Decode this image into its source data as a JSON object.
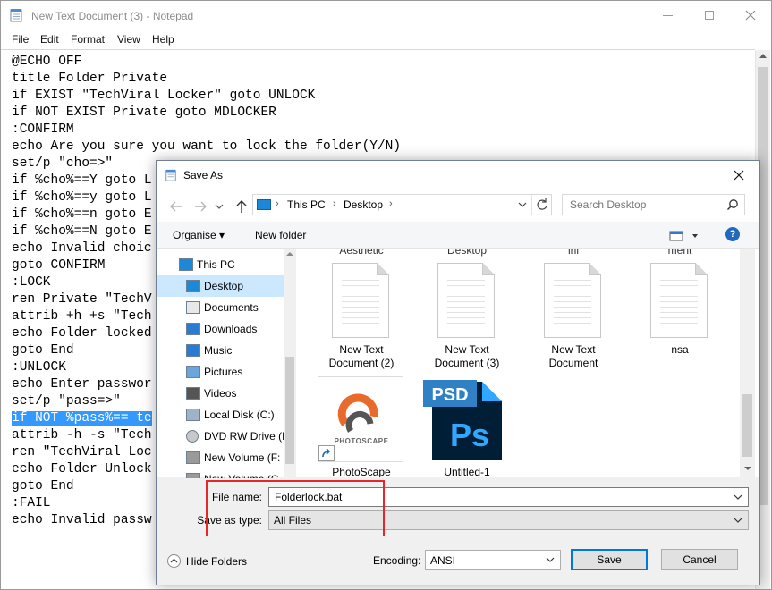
{
  "notepad": {
    "title": "New Text Document (3) - Notepad",
    "menu": [
      "File",
      "Edit",
      "Format",
      "View",
      "Help"
    ],
    "lines": [
      "@ECHO OFF",
      "title Folder Private",
      "if EXIST \"TechViral Locker\" goto UNLOCK",
      "if NOT EXIST Private goto MDLOCKER",
      ":CONFIRM",
      "echo Are you sure you want to lock the folder(Y/N)",
      "set/p \"cho=>\"",
      "if %cho%==Y goto L",
      "if %cho%==y goto L",
      "if %cho%==n goto E",
      "if %cho%==N goto E",
      "echo Invalid choic",
      "goto CONFIRM",
      ":LOCK",
      "ren Private \"TechV",
      "attrib +h +s \"Tech",
      "echo Folder locked",
      "goto End",
      ":UNLOCK",
      "echo Enter passwor",
      "set/p \"pass=>\"",
      "if NOT %pass%== te",
      "attrib -h -s \"Tech",
      "ren \"TechViral Loc",
      "echo Folder Unlock",
      "goto End",
      ":FAIL",
      "echo Invalid passw"
    ],
    "selected_line_index": 21
  },
  "dialog": {
    "title": "Save As",
    "breadcrumbs": [
      "This PC",
      "Desktop"
    ],
    "search_placeholder": "Search Desktop",
    "toolbar": {
      "organise": "Organise",
      "new_folder": "New folder",
      "help": "?"
    },
    "nav_items": [
      {
        "label": "This PC",
        "icon": "computer-icon",
        "indent": 0
      },
      {
        "label": "Desktop",
        "icon": "desktop-icon",
        "indent": 1,
        "selected": true
      },
      {
        "label": "Documents",
        "icon": "documents-icon",
        "indent": 1
      },
      {
        "label": "Downloads",
        "icon": "downloads-icon",
        "indent": 1
      },
      {
        "label": "Music",
        "icon": "music-icon",
        "indent": 1
      },
      {
        "label": "Pictures",
        "icon": "pictures-icon",
        "indent": 1
      },
      {
        "label": "Videos",
        "icon": "videos-icon",
        "indent": 1
      },
      {
        "label": "Local Disk (C:)",
        "icon": "local-disk-icon",
        "indent": 1
      },
      {
        "label": "DVD RW Drive (E",
        "icon": "dvd-drive-icon",
        "indent": 1
      },
      {
        "label": "New Volume (F:",
        "icon": "volume-icon",
        "indent": 1
      },
      {
        "label": "New Volume (G",
        "icon": "volume-icon",
        "indent": 1
      }
    ],
    "top_row_partial": [
      "Aesthetic",
      "Desktop",
      "ini",
      "ment"
    ],
    "files": [
      {
        "label_line1": "New Text",
        "label_line2": "Document (2)",
        "type": "text-document"
      },
      {
        "label_line1": "New Text",
        "label_line2": "Document (3)",
        "type": "text-document"
      },
      {
        "label_line1": "New Text",
        "label_line2": "Document",
        "type": "text-document"
      },
      {
        "label_line1": "nsa",
        "label_line2": "",
        "type": "text-document"
      },
      {
        "label_line1": "PhotoScape",
        "label_line2": "",
        "type": "shortcut",
        "logo_text": "PHOTOSCAPE"
      },
      {
        "label_line1": "Untitled-1",
        "label_line2": "",
        "type": "psd",
        "badge": "PSD",
        "mark": "Ps"
      }
    ],
    "file_name_label": "File name:",
    "file_name_value": "Folderlock.bat",
    "save_type_label": "Save as type:",
    "save_type_value": "All Files",
    "hide_folders": "Hide Folders",
    "encoding_label": "Encoding:",
    "encoding_value": "ANSI",
    "save_button": "Save",
    "cancel_button": "Cancel"
  },
  "colors": {
    "selection": "#3399ff",
    "nav_selected": "#cce8ff",
    "highlight_box": "#e8262a",
    "psd_blue": "#31a8ff",
    "psd_dark": "#001e36"
  }
}
